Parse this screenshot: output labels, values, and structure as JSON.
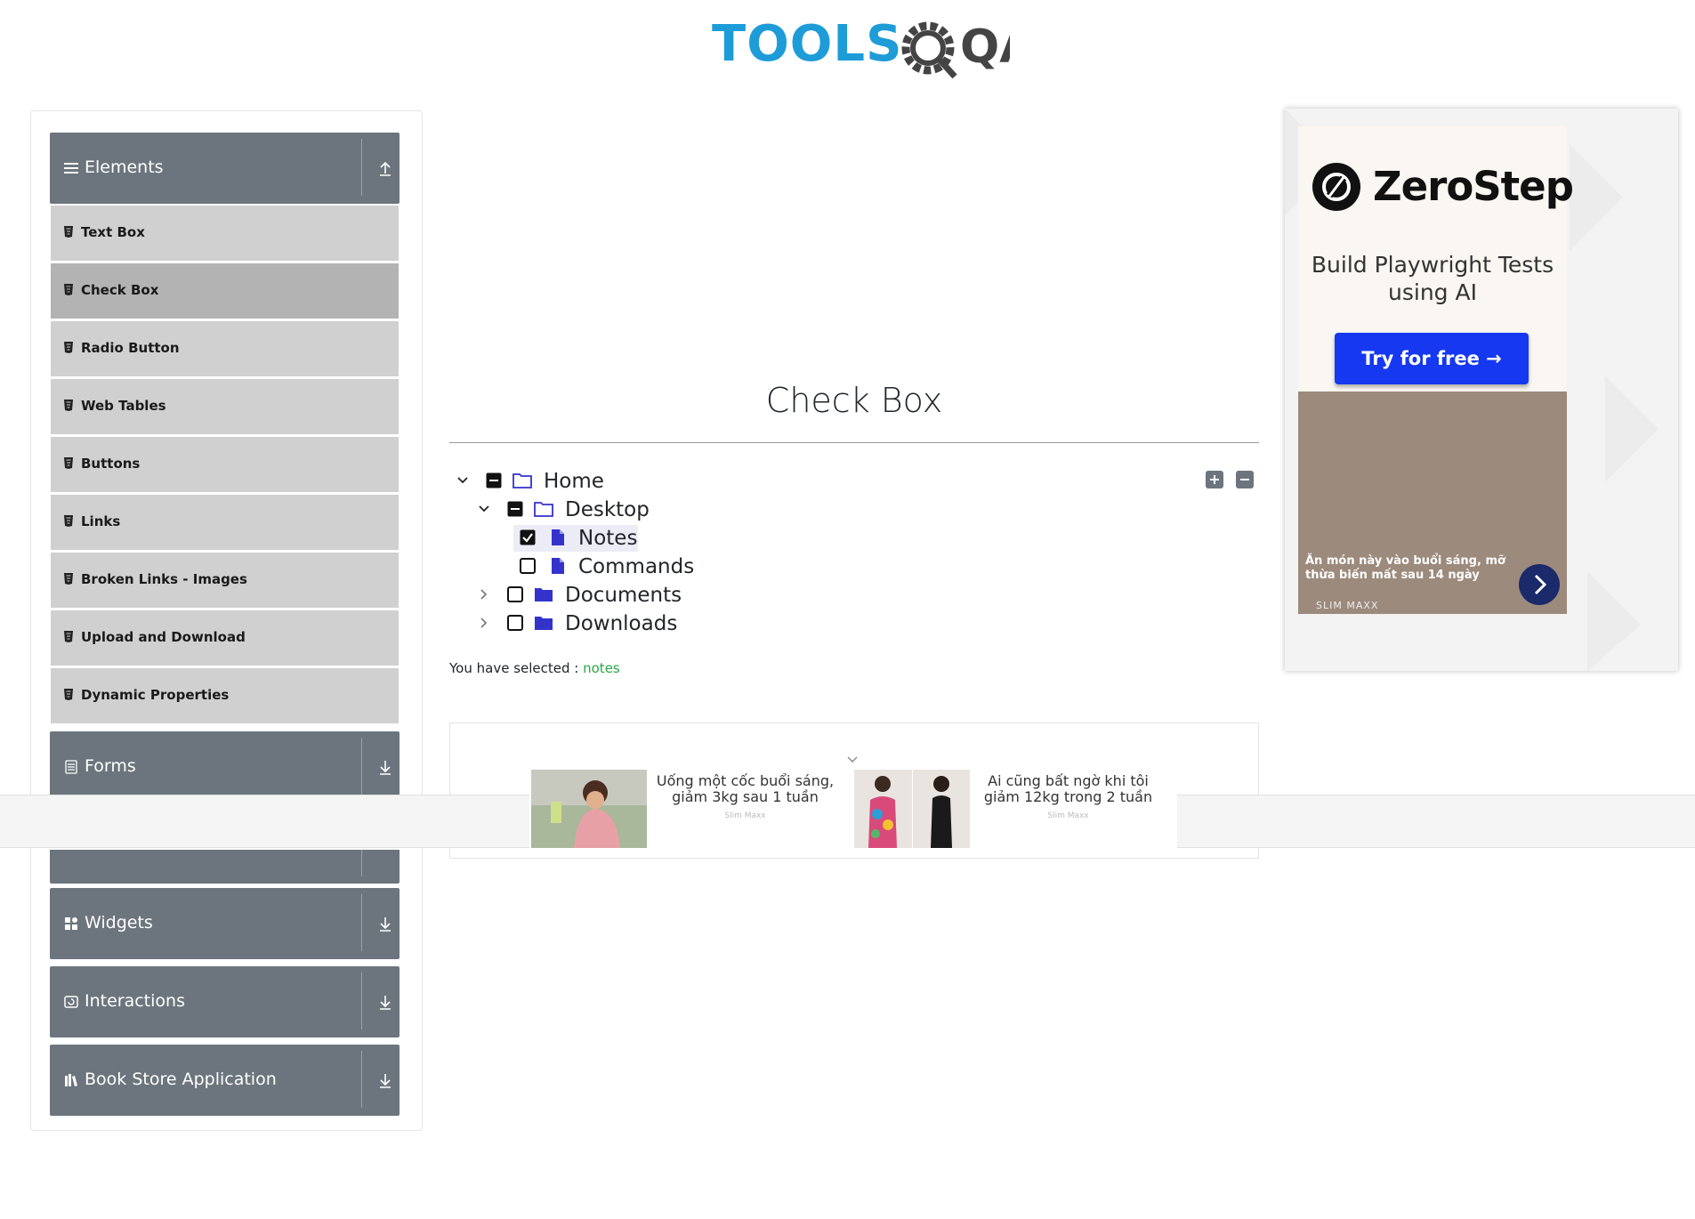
{
  "brand": {
    "logo_text": "TOOLS",
    "logo_suffix": "QA"
  },
  "sidebar": {
    "groups": [
      {
        "label": "Elements",
        "icon": "hamburger-icon",
        "arrow": "collapse-up-icon"
      },
      {
        "label": "Forms",
        "icon": "form-icon",
        "arrow": "expand-down-icon"
      },
      {
        "label": "Widgets",
        "icon": "widgets-icon",
        "arrow": "expand-down-icon"
      },
      {
        "label": "Interactions",
        "icon": "interactions-icon",
        "arrow": "expand-down-icon"
      },
      {
        "label": "Book Store Application",
        "icon": "book-icon",
        "arrow": "expand-down-icon"
      }
    ],
    "items": [
      {
        "label": "Text Box"
      },
      {
        "label": "Check Box",
        "active": true
      },
      {
        "label": "Radio Button"
      },
      {
        "label": "Web Tables"
      },
      {
        "label": "Buttons"
      },
      {
        "label": "Links"
      },
      {
        "label": "Broken Links - Images"
      },
      {
        "label": "Upload and Download"
      },
      {
        "label": "Dynamic Properties"
      }
    ]
  },
  "main": {
    "title": "Check Box",
    "tree": [
      {
        "label": "Home",
        "state": "partial",
        "expanded": true
      },
      {
        "label": "Desktop",
        "state": "partial",
        "expanded": true
      },
      {
        "label": "Notes",
        "state": "checked"
      },
      {
        "label": "Commands",
        "state": "unchecked"
      },
      {
        "label": "Documents",
        "state": "unchecked",
        "expanded": false
      },
      {
        "label": "Downloads",
        "state": "unchecked",
        "expanded": false
      }
    ],
    "expand_all_label": "Expand all",
    "collapse_all_label": "Collapse all",
    "result_prefix": "You have selected :",
    "result_value": "notes"
  },
  "bottom_ad": {
    "cards": [
      {
        "text": "Uống một cốc buổi sáng, giảm 3kg sau 1 tuần",
        "source": "Slim Maxx"
      },
      {
        "text": "Ai cũng bất ngờ khi tôi giảm 12kg trong 2 tuần",
        "source": "Slim Maxx"
      }
    ]
  },
  "right_ad": {
    "brand": "ZeroStep",
    "tagline": "Build Playwright Tests using AI",
    "cta": "Try for free →",
    "caption": "Ăn món này vào buổi sáng, mỡ thừa biến mất sau 14 ngày",
    "source": "SLIM MAXX"
  },
  "colors": {
    "logo_blue": "#1d9cd8",
    "sidebar_group": "#6c757d",
    "sidebar_item": "#d0d0d0",
    "sidebar_item_active": "#b3b3b3",
    "folder_blue": "#3333cc",
    "result_green": "#28a745",
    "cta_blue": "#1538f0"
  }
}
